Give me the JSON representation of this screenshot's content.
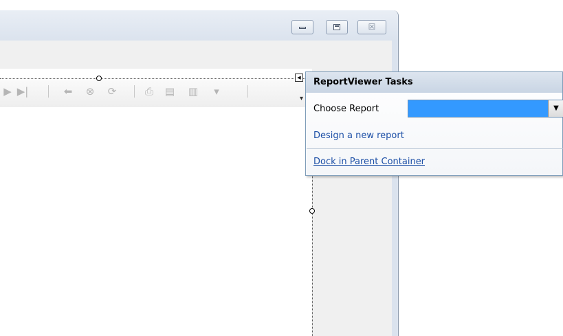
{
  "window": {
    "buttons": {
      "minimize_icon": "minimize-icon",
      "maximize_icon": "maximize-icon",
      "close_glyph": "☒"
    }
  },
  "toolbar": {
    "icons": [
      "next-page-icon",
      "last-page-icon",
      "back-icon",
      "stop-icon",
      "refresh-icon",
      "print-icon",
      "print-layout-icon",
      "page-setup-icon",
      "export-icon"
    ]
  },
  "tasks_panel": {
    "title": "ReportViewer Tasks",
    "choose_report_label": "Choose Report",
    "choose_report_value": "",
    "link_design": "Design a new report",
    "link_dock": "Dock in Parent Container"
  },
  "colors": {
    "selection": "#3399ff",
    "link": "#1c4fa6",
    "header_bg": "#c9d5e4"
  }
}
